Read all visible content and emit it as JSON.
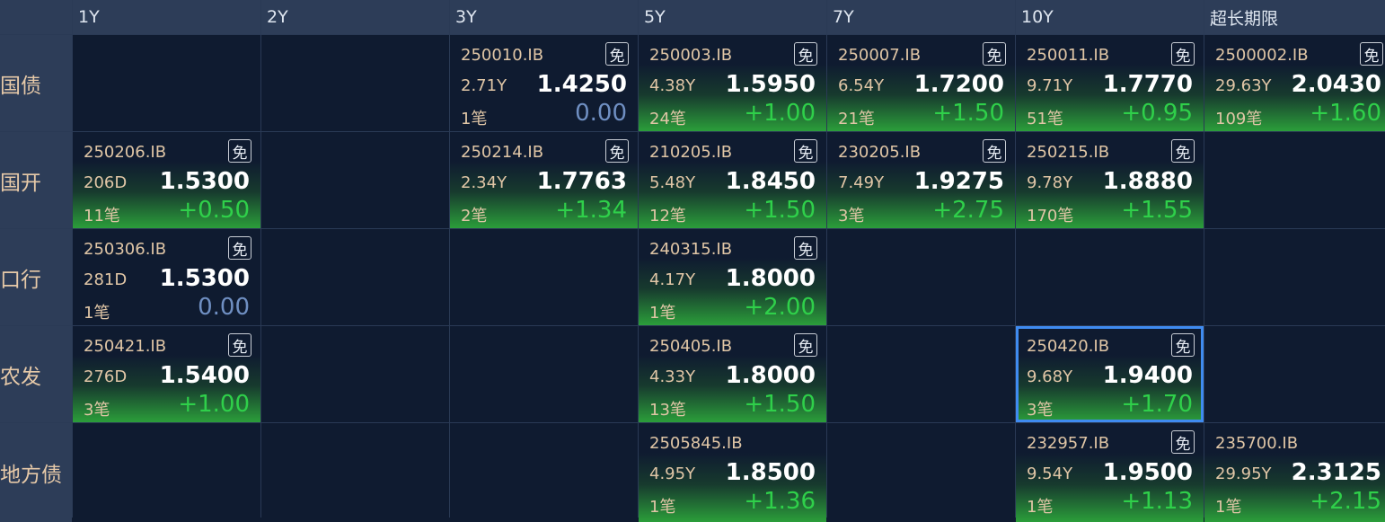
{
  "columns": [
    "1Y",
    "2Y",
    "3Y",
    "5Y",
    "7Y",
    "10Y",
    "超长期限"
  ],
  "badge_text": "免",
  "colors": {
    "up": "#2fd04a",
    "flat": "#6f8fc2",
    "selected_outline": "#3f8bf0"
  },
  "rows": [
    {
      "label": "国债",
      "cells": [
        null,
        null,
        {
          "code": "250010.IB",
          "badge": true,
          "maturity": "2.71Y",
          "price": "1.4250",
          "count": "1笔",
          "change": "0.00",
          "flat": true
        },
        {
          "code": "250003.IB",
          "badge": true,
          "maturity": "4.38Y",
          "price": "1.5950",
          "count": "24笔",
          "change": "+1.00"
        },
        {
          "code": "250007.IB",
          "badge": true,
          "maturity": "6.54Y",
          "price": "1.7200",
          "count": "21笔",
          "change": "+1.50"
        },
        {
          "code": "250011.IB",
          "badge": true,
          "maturity": "9.71Y",
          "price": "1.7770",
          "count": "51笔",
          "change": "+0.95"
        },
        {
          "code": "2500002.IB",
          "badge": true,
          "maturity": "29.63Y",
          "price": "2.0430",
          "count": "109笔",
          "change": "+1.60"
        }
      ]
    },
    {
      "label": "国开",
      "cells": [
        {
          "code": "250206.IB",
          "badge": true,
          "maturity": "206D",
          "price": "1.5300",
          "count": "11笔",
          "change": "+0.50"
        },
        null,
        {
          "code": "250214.IB",
          "badge": true,
          "maturity": "2.34Y",
          "price": "1.7763",
          "count": "2笔",
          "change": "+1.34"
        },
        {
          "code": "210205.IB",
          "badge": true,
          "maturity": "5.48Y",
          "price": "1.8450",
          "count": "12笔",
          "change": "+1.50"
        },
        {
          "code": "230205.IB",
          "badge": true,
          "maturity": "7.49Y",
          "price": "1.9275",
          "count": "3笔",
          "change": "+2.75"
        },
        {
          "code": "250215.IB",
          "badge": true,
          "maturity": "9.78Y",
          "price": "1.8880",
          "count": "170笔",
          "change": "+1.55"
        },
        null
      ]
    },
    {
      "label": "口行",
      "cells": [
        {
          "code": "250306.IB",
          "badge": true,
          "maturity": "281D",
          "price": "1.5300",
          "count": "1笔",
          "change": "0.00",
          "flat": true
        },
        null,
        null,
        {
          "code": "240315.IB",
          "badge": true,
          "maturity": "4.17Y",
          "price": "1.8000",
          "count": "1笔",
          "change": "+2.00"
        },
        null,
        null,
        null
      ]
    },
    {
      "label": "农发",
      "cells": [
        {
          "code": "250421.IB",
          "badge": true,
          "maturity": "276D",
          "price": "1.5400",
          "count": "3笔",
          "change": "+1.00"
        },
        null,
        null,
        {
          "code": "250405.IB",
          "badge": true,
          "maturity": "4.33Y",
          "price": "1.8000",
          "count": "13笔",
          "change": "+1.50"
        },
        null,
        {
          "code": "250420.IB",
          "badge": true,
          "maturity": "9.68Y",
          "price": "1.9400",
          "count": "3笔",
          "change": "+1.70",
          "selected": true
        },
        null
      ]
    },
    {
      "label": "地方债",
      "cells": [
        null,
        null,
        null,
        {
          "code": "2505845.IB",
          "badge": false,
          "maturity": "4.95Y",
          "price": "1.8500",
          "count": "1笔",
          "change": "+1.36"
        },
        null,
        {
          "code": "232957.IB",
          "badge": true,
          "maturity": "9.54Y",
          "price": "1.9500",
          "count": "1笔",
          "change": "+1.13"
        },
        {
          "code": "235700.IB",
          "badge": false,
          "maturity": "29.95Y",
          "price": "2.3125",
          "count": "1笔",
          "change": "+2.15"
        }
      ]
    }
  ]
}
